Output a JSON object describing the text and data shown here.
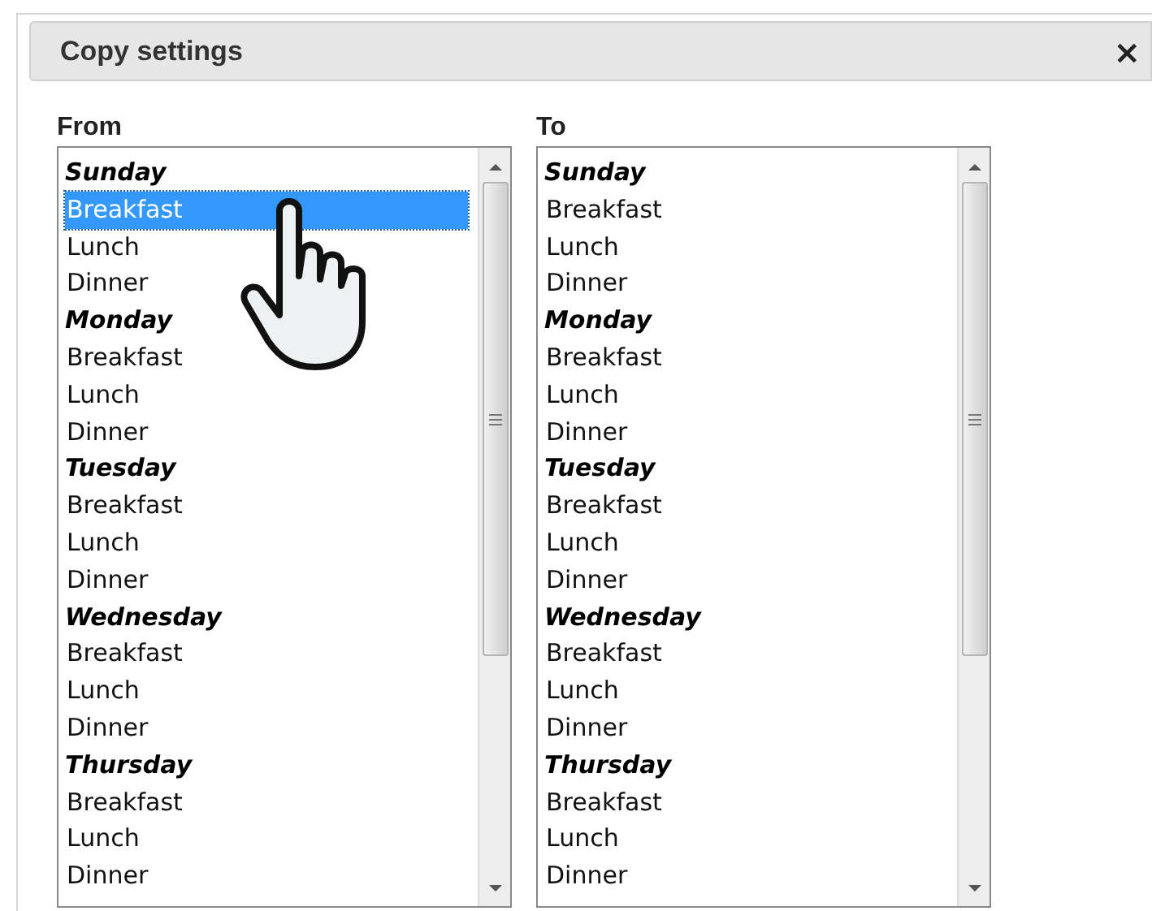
{
  "dialog": {
    "title": "Copy settings",
    "close": "×"
  },
  "lists": [
    {
      "label": "From",
      "groups": [
        {
          "label": "Sunday",
          "options": [
            {
              "label": "Breakfast",
              "selected": true
            },
            {
              "label": "Lunch",
              "selected": false
            },
            {
              "label": "Dinner",
              "selected": false
            }
          ]
        },
        {
          "label": "Monday",
          "options": [
            {
              "label": "Breakfast",
              "selected": false
            },
            {
              "label": "Lunch",
              "selected": false
            },
            {
              "label": "Dinner",
              "selected": false
            }
          ]
        },
        {
          "label": "Tuesday",
          "options": [
            {
              "label": "Breakfast",
              "selected": false
            },
            {
              "label": "Lunch",
              "selected": false
            },
            {
              "label": "Dinner",
              "selected": false
            }
          ]
        },
        {
          "label": "Wednesday",
          "options": [
            {
              "label": "Breakfast",
              "selected": false
            },
            {
              "label": "Lunch",
              "selected": false
            },
            {
              "label": "Dinner",
              "selected": false
            }
          ]
        },
        {
          "label": "Thursday",
          "options": [
            {
              "label": "Breakfast",
              "selected": false
            },
            {
              "label": "Lunch",
              "selected": false
            },
            {
              "label": "Dinner",
              "selected": false
            }
          ]
        }
      ]
    },
    {
      "label": "To",
      "groups": [
        {
          "label": "Sunday",
          "options": [
            {
              "label": "Breakfast",
              "selected": false
            },
            {
              "label": "Lunch",
              "selected": false
            },
            {
              "label": "Dinner",
              "selected": false
            }
          ]
        },
        {
          "label": "Monday",
          "options": [
            {
              "label": "Breakfast",
              "selected": false
            },
            {
              "label": "Lunch",
              "selected": false
            },
            {
              "label": "Dinner",
              "selected": false
            }
          ]
        },
        {
          "label": "Tuesday",
          "options": [
            {
              "label": "Breakfast",
              "selected": false
            },
            {
              "label": "Lunch",
              "selected": false
            },
            {
              "label": "Dinner",
              "selected": false
            }
          ]
        },
        {
          "label": "Wednesday",
          "options": [
            {
              "label": "Breakfast",
              "selected": false
            },
            {
              "label": "Lunch",
              "selected": false
            },
            {
              "label": "Dinner",
              "selected": false
            }
          ]
        },
        {
          "label": "Thursday",
          "options": [
            {
              "label": "Breakfast",
              "selected": false
            },
            {
              "label": "Lunch",
              "selected": false
            },
            {
              "label": "Dinner",
              "selected": false
            }
          ]
        }
      ]
    }
  ]
}
